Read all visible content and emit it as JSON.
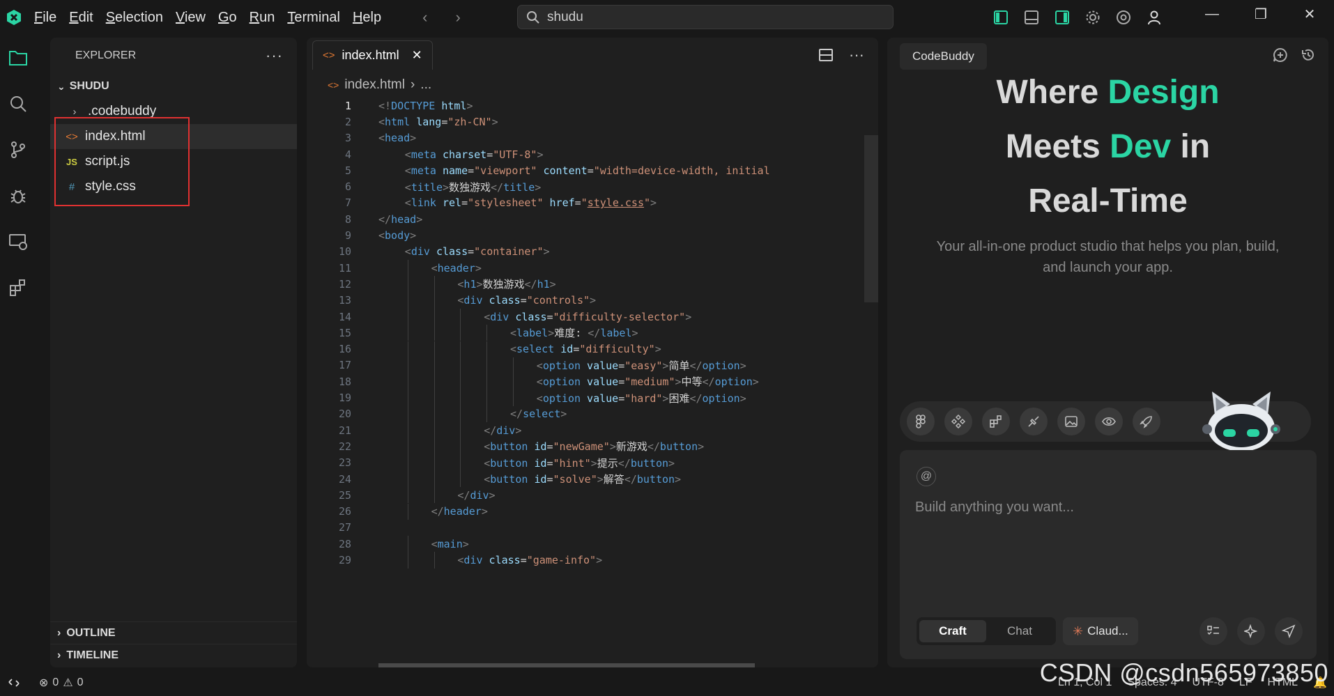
{
  "menu": [
    {
      "label": "File",
      "u": "F",
      "rest": "ile"
    },
    {
      "label": "Edit",
      "u": "E",
      "rest": "dit"
    },
    {
      "label": "Selection",
      "u": "S",
      "rest": "election"
    },
    {
      "label": "View",
      "u": "V",
      "rest": "iew"
    },
    {
      "label": "Go",
      "u": "G",
      "rest": "o"
    },
    {
      "label": "Run",
      "u": "R",
      "rest": "un"
    },
    {
      "label": "Terminal",
      "u": "T",
      "rest": "erminal"
    },
    {
      "label": "Help",
      "u": "H",
      "rest": "elp"
    }
  ],
  "search": {
    "value": "shudu"
  },
  "sidebar": {
    "title": "EXPLORER",
    "folder": "SHUDU",
    "items": [
      {
        "name": ".codebuddy",
        "icon": "chevron-right-icon"
      },
      {
        "name": "index.html",
        "icon": "html-file-icon",
        "glyph": "<>",
        "color": "#e37933"
      },
      {
        "name": "script.js",
        "icon": "js-file-icon",
        "glyph": "JS",
        "color": "#cbcb41"
      },
      {
        "name": "style.css",
        "icon": "css-file-icon",
        "glyph": "#",
        "color": "#519aba"
      }
    ],
    "outline": "OUTLINE",
    "timeline": "TIMELINE"
  },
  "editor": {
    "tab": "index.html",
    "breadcrumb_file": "index.html",
    "breadcrumb_more": "...",
    "lines": [
      {
        "n": "1",
        "i": 0,
        "t": [
          [
            "br",
            "<!"
          ],
          [
            "kw",
            "DOCTYPE"
          ],
          [
            "text",
            " "
          ],
          [
            "attr",
            "html"
          ],
          [
            "br",
            ">"
          ]
        ]
      },
      {
        "n": "2",
        "i": 0,
        "t": [
          [
            "br",
            "<"
          ],
          [
            "tag",
            "html"
          ],
          [
            "text",
            " "
          ],
          [
            "attr",
            "lang"
          ],
          [
            "text",
            "="
          ],
          [
            "str",
            "\"zh-CN\""
          ],
          [
            "br",
            ">"
          ]
        ]
      },
      {
        "n": "3",
        "i": 0,
        "t": [
          [
            "br",
            "<"
          ],
          [
            "tag",
            "head"
          ],
          [
            "br",
            ">"
          ]
        ]
      },
      {
        "n": "4",
        "i": 1,
        "t": [
          [
            "br",
            "<"
          ],
          [
            "tag",
            "meta"
          ],
          [
            "text",
            " "
          ],
          [
            "attr",
            "charset"
          ],
          [
            "text",
            "="
          ],
          [
            "str",
            "\"UTF-8\""
          ],
          [
            "br",
            ">"
          ]
        ]
      },
      {
        "n": "5",
        "i": 1,
        "t": [
          [
            "br",
            "<"
          ],
          [
            "tag",
            "meta"
          ],
          [
            "text",
            " "
          ],
          [
            "attr",
            "name"
          ],
          [
            "text",
            "="
          ],
          [
            "str",
            "\"viewport\""
          ],
          [
            "text",
            " "
          ],
          [
            "attr",
            "content"
          ],
          [
            "text",
            "="
          ],
          [
            "str",
            "\"width=device-width, initial"
          ]
        ]
      },
      {
        "n": "6",
        "i": 1,
        "t": [
          [
            "br",
            "<"
          ],
          [
            "tag",
            "title"
          ],
          [
            "br",
            ">"
          ],
          [
            "text",
            "数独游戏"
          ],
          [
            "br",
            "</"
          ],
          [
            "tag",
            "title"
          ],
          [
            "br",
            ">"
          ]
        ]
      },
      {
        "n": "7",
        "i": 1,
        "t": [
          [
            "br",
            "<"
          ],
          [
            "tag",
            "link"
          ],
          [
            "text",
            " "
          ],
          [
            "attr",
            "rel"
          ],
          [
            "text",
            "="
          ],
          [
            "str",
            "\"stylesheet\""
          ],
          [
            "text",
            " "
          ],
          [
            "attr",
            "href"
          ],
          [
            "text",
            "="
          ],
          [
            "str",
            "\""
          ],
          [
            "link",
            "style.css"
          ],
          [
            "str",
            "\""
          ],
          [
            "br",
            ">"
          ]
        ]
      },
      {
        "n": "8",
        "i": 0,
        "t": [
          [
            "br",
            "</"
          ],
          [
            "tag",
            "head"
          ],
          [
            "br",
            ">"
          ]
        ]
      },
      {
        "n": "9",
        "i": 0,
        "t": [
          [
            "br",
            "<"
          ],
          [
            "tag",
            "body"
          ],
          [
            "br",
            ">"
          ]
        ]
      },
      {
        "n": "10",
        "i": 1,
        "t": [
          [
            "br",
            "<"
          ],
          [
            "tag",
            "div"
          ],
          [
            "text",
            " "
          ],
          [
            "attr",
            "class"
          ],
          [
            "text",
            "="
          ],
          [
            "str",
            "\"container\""
          ],
          [
            "br",
            ">"
          ]
        ]
      },
      {
        "n": "11",
        "i": 2,
        "t": [
          [
            "br",
            "<"
          ],
          [
            "tag",
            "header"
          ],
          [
            "br",
            ">"
          ]
        ]
      },
      {
        "n": "12",
        "i": 3,
        "t": [
          [
            "br",
            "<"
          ],
          [
            "tag",
            "h1"
          ],
          [
            "br",
            ">"
          ],
          [
            "text",
            "数独游戏"
          ],
          [
            "br",
            "</"
          ],
          [
            "tag",
            "h1"
          ],
          [
            "br",
            ">"
          ]
        ]
      },
      {
        "n": "13",
        "i": 3,
        "t": [
          [
            "br",
            "<"
          ],
          [
            "tag",
            "div"
          ],
          [
            "text",
            " "
          ],
          [
            "attr",
            "class"
          ],
          [
            "text",
            "="
          ],
          [
            "str",
            "\"controls\""
          ],
          [
            "br",
            ">"
          ]
        ]
      },
      {
        "n": "14",
        "i": 4,
        "t": [
          [
            "br",
            "<"
          ],
          [
            "tag",
            "div"
          ],
          [
            "text",
            " "
          ],
          [
            "attr",
            "class"
          ],
          [
            "text",
            "="
          ],
          [
            "str",
            "\"difficulty-selector\""
          ],
          [
            "br",
            ">"
          ]
        ]
      },
      {
        "n": "15",
        "i": 5,
        "t": [
          [
            "br",
            "<"
          ],
          [
            "tag",
            "label"
          ],
          [
            "br",
            ">"
          ],
          [
            "text",
            "难度: "
          ],
          [
            "br",
            "</"
          ],
          [
            "tag",
            "label"
          ],
          [
            "br",
            ">"
          ]
        ]
      },
      {
        "n": "16",
        "i": 5,
        "t": [
          [
            "br",
            "<"
          ],
          [
            "tag",
            "select"
          ],
          [
            "text",
            " "
          ],
          [
            "attr",
            "id"
          ],
          [
            "text",
            "="
          ],
          [
            "str",
            "\"difficulty\""
          ],
          [
            "br",
            ">"
          ]
        ]
      },
      {
        "n": "17",
        "i": 6,
        "t": [
          [
            "br",
            "<"
          ],
          [
            "tag",
            "option"
          ],
          [
            "text",
            " "
          ],
          [
            "attr",
            "value"
          ],
          [
            "text",
            "="
          ],
          [
            "str",
            "\"easy\""
          ],
          [
            "br",
            ">"
          ],
          [
            "text",
            "简单"
          ],
          [
            "br",
            "</"
          ],
          [
            "tag",
            "option"
          ],
          [
            "br",
            ">"
          ]
        ]
      },
      {
        "n": "18",
        "i": 6,
        "t": [
          [
            "br",
            "<"
          ],
          [
            "tag",
            "option"
          ],
          [
            "text",
            " "
          ],
          [
            "attr",
            "value"
          ],
          [
            "text",
            "="
          ],
          [
            "str",
            "\"medium\""
          ],
          [
            "br",
            ">"
          ],
          [
            "text",
            "中等"
          ],
          [
            "br",
            "</"
          ],
          [
            "tag",
            "option"
          ],
          [
            "br",
            ">"
          ]
        ]
      },
      {
        "n": "19",
        "i": 6,
        "t": [
          [
            "br",
            "<"
          ],
          [
            "tag",
            "option"
          ],
          [
            "text",
            " "
          ],
          [
            "attr",
            "value"
          ],
          [
            "text",
            "="
          ],
          [
            "str",
            "\"hard\""
          ],
          [
            "br",
            ">"
          ],
          [
            "text",
            "困难"
          ],
          [
            "br",
            "</"
          ],
          [
            "tag",
            "option"
          ],
          [
            "br",
            ">"
          ]
        ]
      },
      {
        "n": "20",
        "i": 5,
        "t": [
          [
            "br",
            "</"
          ],
          [
            "tag",
            "select"
          ],
          [
            "br",
            ">"
          ]
        ]
      },
      {
        "n": "21",
        "i": 4,
        "t": [
          [
            "br",
            "</"
          ],
          [
            "tag",
            "div"
          ],
          [
            "br",
            ">"
          ]
        ]
      },
      {
        "n": "22",
        "i": 4,
        "t": [
          [
            "br",
            "<"
          ],
          [
            "tag",
            "button"
          ],
          [
            "text",
            " "
          ],
          [
            "attr",
            "id"
          ],
          [
            "text",
            "="
          ],
          [
            "str",
            "\"newGame\""
          ],
          [
            "br",
            ">"
          ],
          [
            "text",
            "新游戏"
          ],
          [
            "br",
            "</"
          ],
          [
            "tag",
            "button"
          ],
          [
            "br",
            ">"
          ]
        ]
      },
      {
        "n": "23",
        "i": 4,
        "t": [
          [
            "br",
            "<"
          ],
          [
            "tag",
            "button"
          ],
          [
            "text",
            " "
          ],
          [
            "attr",
            "id"
          ],
          [
            "text",
            "="
          ],
          [
            "str",
            "\"hint\""
          ],
          [
            "br",
            ">"
          ],
          [
            "text",
            "提示"
          ],
          [
            "br",
            "</"
          ],
          [
            "tag",
            "button"
          ],
          [
            "br",
            ">"
          ]
        ]
      },
      {
        "n": "24",
        "i": 4,
        "t": [
          [
            "br",
            "<"
          ],
          [
            "tag",
            "button"
          ],
          [
            "text",
            " "
          ],
          [
            "attr",
            "id"
          ],
          [
            "text",
            "="
          ],
          [
            "str",
            "\"solve\""
          ],
          [
            "br",
            ">"
          ],
          [
            "text",
            "解答"
          ],
          [
            "br",
            "</"
          ],
          [
            "tag",
            "button"
          ],
          [
            "br",
            ">"
          ]
        ]
      },
      {
        "n": "25",
        "i": 3,
        "t": [
          [
            "br",
            "</"
          ],
          [
            "tag",
            "div"
          ],
          [
            "br",
            ">"
          ]
        ]
      },
      {
        "n": "26",
        "i": 2,
        "t": [
          [
            "br",
            "</"
          ],
          [
            "tag",
            "header"
          ],
          [
            "br",
            ">"
          ]
        ]
      },
      {
        "n": "27",
        "i": 0,
        "t": []
      },
      {
        "n": "28",
        "i": 2,
        "t": [
          [
            "br",
            "<"
          ],
          [
            "tag",
            "main"
          ],
          [
            "br",
            ">"
          ]
        ]
      },
      {
        "n": "29",
        "i": 3,
        "t": [
          [
            "br",
            "<"
          ],
          [
            "tag",
            "div"
          ],
          [
            "text",
            " "
          ],
          [
            "attr",
            "class"
          ],
          [
            "text",
            "="
          ],
          [
            "str",
            "\"game-info\""
          ],
          [
            "br",
            ">"
          ]
        ]
      }
    ]
  },
  "panel": {
    "tab": "CodeBuddy",
    "hero_line1_a": "Where ",
    "hero_line1_b": "Design",
    "hero_line2_a": "Meets ",
    "hero_line2_b": "Dev",
    "hero_line2_c": " in",
    "hero_line3": "Real-Time",
    "subtitle": "Your all-in-one product studio that helps you plan, build, and launch your app.",
    "input_placeholder": "Build anything you want...",
    "at_label": "@",
    "mode_craft": "Craft",
    "mode_chat": "Chat",
    "model": "Claud..."
  },
  "status": {
    "errors": "0",
    "warnings": "0",
    "position": "Ln 1, Col 1",
    "spaces": "Spaces: 4",
    "encoding": "UTF-8",
    "eol": "LF",
    "language": "HTML"
  },
  "watermark": "CSDN @csdn565973850",
  "colors": {
    "accent": "#2bd5a4",
    "highlight": "#e03131"
  }
}
